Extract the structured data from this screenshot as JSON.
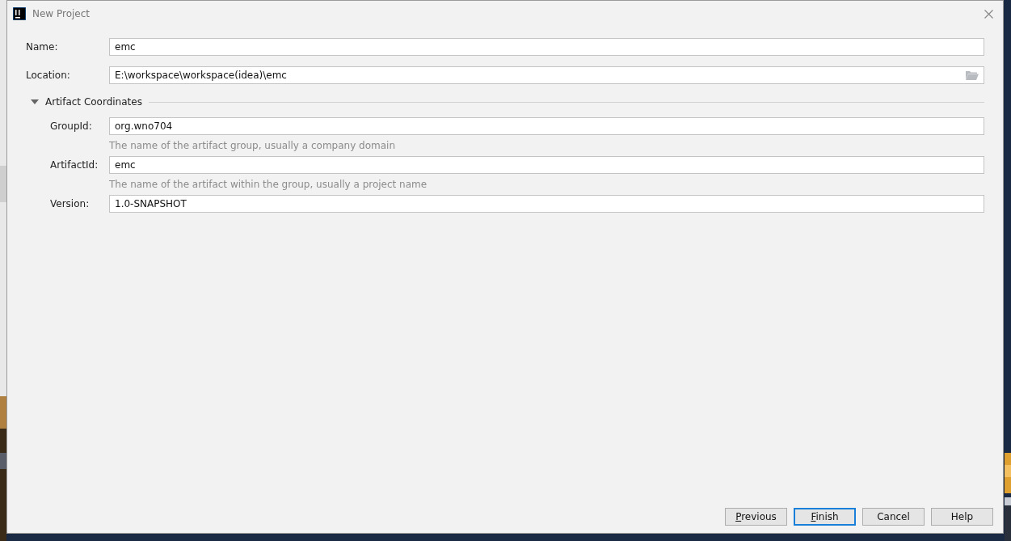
{
  "window": {
    "title": "New Project"
  },
  "fields": [
    {
      "label": "Name:",
      "value": "emc"
    },
    {
      "label": "Location:",
      "value": "E:\\workspace\\workspace(idea)\\emc",
      "browse": true
    }
  ],
  "section": {
    "title": "Artifact Coordinates",
    "expanded": true,
    "fields": [
      {
        "label": "GroupId:",
        "value": "org.wno704",
        "hint": "The name of the artifact group, usually a company domain"
      },
      {
        "label": "ArtifactId:",
        "value": "emc",
        "hint": "The name of the artifact within the group, usually a project name"
      },
      {
        "label": "Version:",
        "value": "1.0-SNAPSHOT"
      }
    ]
  },
  "buttons": [
    {
      "label": "Previous",
      "mnemonic": true,
      "default": false
    },
    {
      "label": "Finish",
      "mnemonic": true,
      "default": true
    },
    {
      "label": "Cancel",
      "mnemonic": false,
      "default": false
    },
    {
      "label": "Help",
      "mnemonic": false,
      "default": false
    }
  ]
}
